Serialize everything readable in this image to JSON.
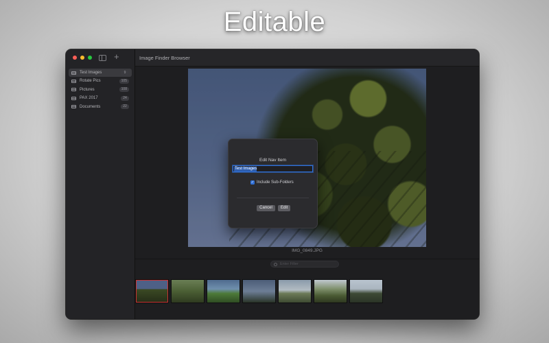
{
  "headline": "Editable",
  "window": {
    "title": "Image Finder Browser"
  },
  "sidebar": {
    "items": [
      {
        "label": "Test Images",
        "count": "9"
      },
      {
        "label": "Rotate Pics",
        "count": "105"
      },
      {
        "label": "Pictures",
        "count": "108"
      },
      {
        "label": "PAX 2017",
        "count": "24"
      },
      {
        "label": "Documents",
        "count": "22"
      }
    ],
    "icons": [
      "sidebar-toggle-icon",
      "add-icon",
      "drive-icon"
    ]
  },
  "viewer": {
    "filename": "IMG_0849.JPG",
    "filter_placeholder": "Enter Filter"
  },
  "dialog": {
    "title": "Edit Nav Item",
    "input_value": "Test Images",
    "checkbox_label": "Include Sub-Folders",
    "checkbox_checked": true,
    "cancel_label": "Cancel",
    "edit_label": "Edit"
  },
  "colors": {
    "accent": "#2f6fd6",
    "window_bg": "#1c1c1e",
    "sidebar_bg": "#232326"
  }
}
